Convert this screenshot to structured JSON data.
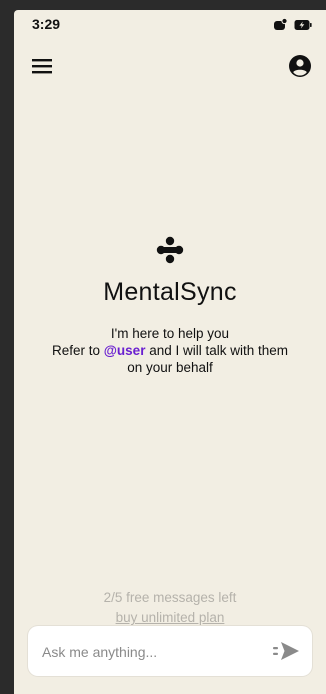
{
  "status_bar": {
    "time": "3:29",
    "icons": [
      "notification-badge-icon",
      "battery-charging-icon"
    ]
  },
  "header": {
    "menu_icon": "hamburger-menu-icon",
    "account_icon": "account-circle-icon"
  },
  "hero": {
    "logo_icon": "four-dot-logo-icon",
    "title": "MentalSync",
    "line1": "I'm here to help you",
    "line2_prefix": "Refer to ",
    "line2_mention": "@user",
    "line2_suffix": " and I will talk with them",
    "line3": "on your behalf"
  },
  "quota": {
    "remaining_text": "2/5 free messages left",
    "upgrade_link": "buy unlimited plan"
  },
  "composer": {
    "placeholder": "Ask me anything...",
    "value": "",
    "send_icon": "send-icon"
  },
  "colors": {
    "background": "#f2eee3",
    "accent": "#6a1fd0",
    "muted": "#b5b2ab"
  }
}
